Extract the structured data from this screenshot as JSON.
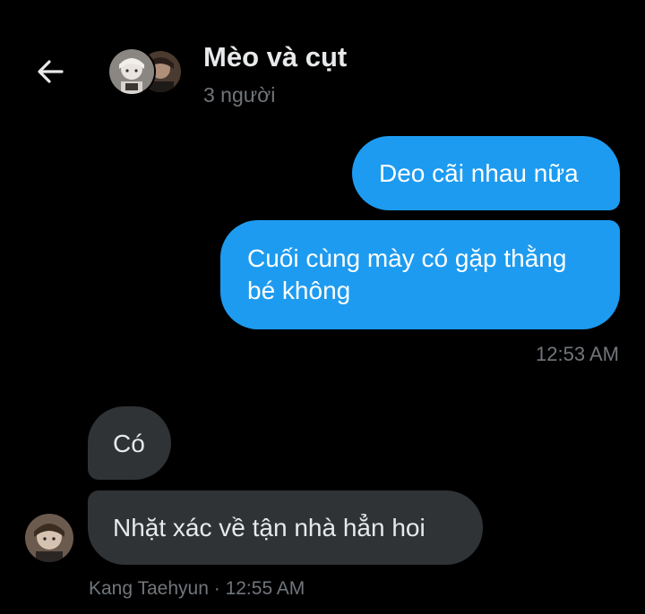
{
  "header": {
    "back_icon": "arrow-left-icon",
    "title": "Mèo và cụt",
    "subtitle": "3 người"
  },
  "messages": [
    {
      "direction": "outgoing",
      "text": "Deo cãi nhau nữa"
    },
    {
      "direction": "outgoing",
      "text": "Cuối cùng mày có gặp thằng bé không"
    },
    {
      "direction": "incoming",
      "text": "Có"
    },
    {
      "direction": "incoming",
      "text": "Nhặt xác về tận nhà hẳn hoi"
    }
  ],
  "outgoing_timestamp": "12:53 AM",
  "incoming_meta": {
    "sender": "Kang Taehyun",
    "separator": " · ",
    "time": "12:55 AM"
  },
  "colors": {
    "background": "#000000",
    "outgoing_bubble": "#1d9bf0",
    "incoming_bubble": "#2f3336",
    "muted_text": "#71767b"
  }
}
